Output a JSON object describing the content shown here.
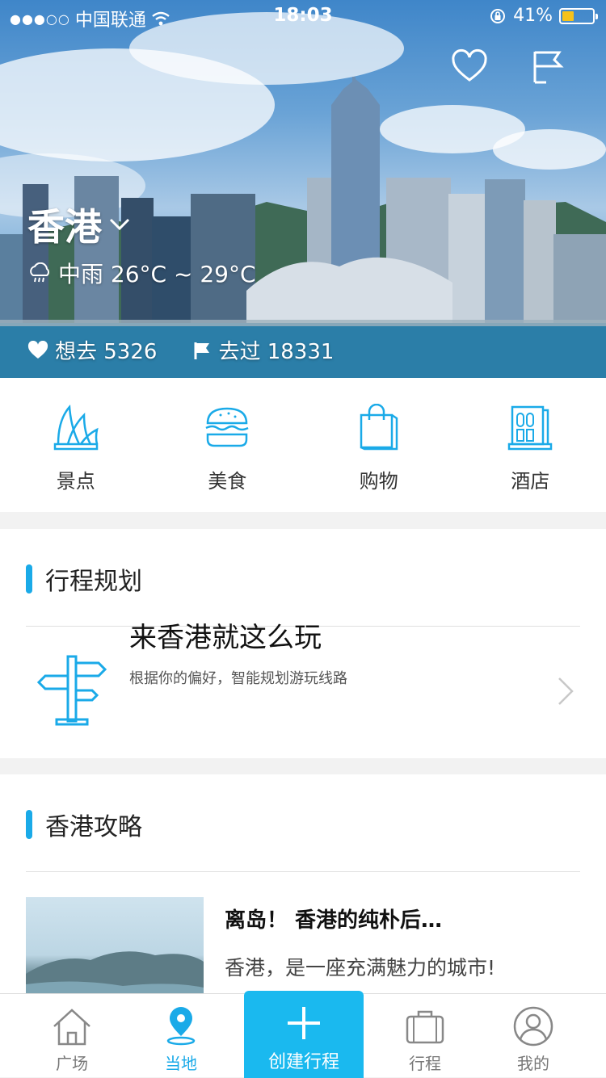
{
  "status_bar": {
    "signal": "●●●○○",
    "carrier": "中国联通",
    "time": "18:03",
    "battery_percent": "41%",
    "battery_level": 0.41
  },
  "hero": {
    "city": "香港",
    "weather": "中雨 26°C ~ 29°C",
    "want_label": "想去 5326",
    "visited_label": "去过 18331",
    "icons": [
      "heart-icon",
      "flag-icon",
      "dropdown-chevron-icon",
      "rain-cloud-icon"
    ]
  },
  "categories": [
    {
      "label": "景点",
      "icon": "opera-house-icon"
    },
    {
      "label": "美食",
      "icon": "burger-icon"
    },
    {
      "label": "购物",
      "icon": "shopping-bag-icon"
    },
    {
      "label": "酒店",
      "icon": "hotel-building-icon"
    }
  ],
  "trip_planning": {
    "title": "行程规划",
    "card_title": "来香港就这么玩",
    "card_subtitle": "根据你的偏好，智能规划游玩线路",
    "icon": "signpost-icon"
  },
  "guide": {
    "title": "香港攻略",
    "article_title": "离岛！ 香港的纯朴后…",
    "article_summary": "香港，是一座充满魅力的城市!"
  },
  "tab_bar": {
    "items": [
      {
        "label": "广场",
        "icon": "house-icon"
      },
      {
        "label": "当地",
        "icon": "location-pin-icon"
      },
      {
        "label": "创建行程",
        "icon": "plus-icon"
      },
      {
        "label": "行程",
        "icon": "suitcase-icon"
      },
      {
        "label": "我的",
        "icon": "user-icon"
      }
    ],
    "active": "当地"
  },
  "colors": {
    "accent": "#1aaae8",
    "create_button": "#1ab9ef",
    "battery": "#f6c21a"
  }
}
